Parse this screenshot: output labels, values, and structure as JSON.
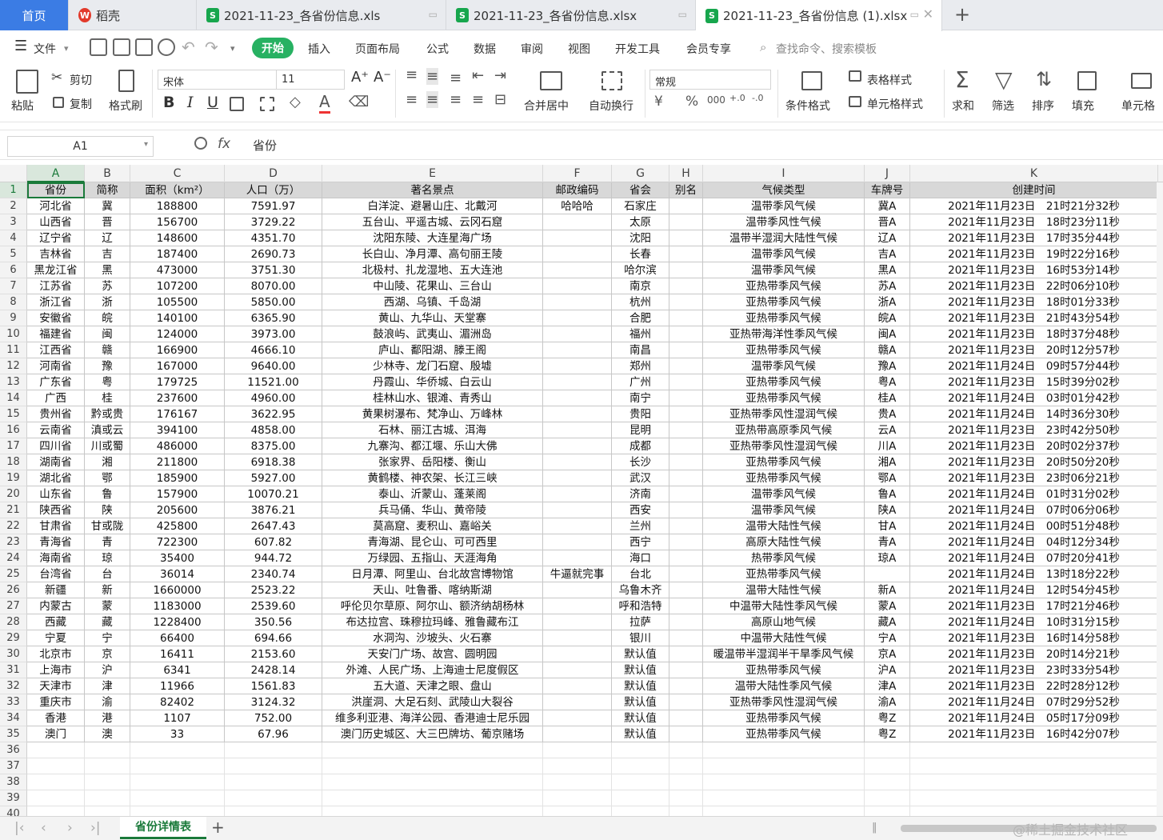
{
  "tabs": {
    "home": "首页",
    "daoke": "稻壳",
    "file1": "2021-11-23_各省份信息.xls",
    "file2": "2021-11-23_各省份信息.xlsx",
    "file3": "2021-11-23_各省份信息 (1).xlsx",
    "add": "+"
  },
  "menu": {
    "file": "文件",
    "items": [
      "开始",
      "插入",
      "页面布局",
      "公式",
      "数据",
      "审阅",
      "视图",
      "开发工具",
      "会员专享"
    ],
    "search": "查找命令、搜索模板"
  },
  "toolbar": {
    "paste": "粘贴",
    "cut": "剪切",
    "copy": "复制",
    "format_painter": "格式刷",
    "font": "宋体",
    "size": "11",
    "bold": "B",
    "italic": "I",
    "underline": "U",
    "merge": "合并居中",
    "wrap": "自动换行",
    "number_format": "常规",
    "cond_format": "条件格式",
    "table_style": "表格样式",
    "cell_style": "单元格样式",
    "sum": "求和",
    "filter": "筛选",
    "sort": "排序",
    "fill": "填充",
    "cell": "单元格"
  },
  "formula": {
    "namebox": "A1",
    "fx": "fx",
    "content": "省份"
  },
  "columns": [
    "A",
    "B",
    "C",
    "D",
    "E",
    "F",
    "G",
    "H",
    "I",
    "J",
    "K"
  ],
  "header_row": [
    "省份",
    "简称",
    "面积（km²）",
    "人口（万）",
    "著名景点",
    "邮政编码",
    "省会",
    "别名",
    "气候类型",
    "车牌号",
    "创建时间"
  ],
  "data_rows": [
    [
      "河北省",
      "冀",
      "188800",
      "7591.97",
      "白洋淀、避暑山庄、北戴河",
      "哈哈哈",
      "石家庄",
      "",
      "温带季风气候",
      "冀A",
      "2021年11月23日　21时21分32秒"
    ],
    [
      "山西省",
      "晋",
      "156700",
      "3729.22",
      "五台山、平遥古城、云冈石窟",
      "",
      "太原",
      "",
      "温带季风性气候",
      "晋A",
      "2021年11月23日　18时23分11秒"
    ],
    [
      "辽宁省",
      "辽",
      "148600",
      "4351.70",
      "沈阳东陵、大连星海广场",
      "",
      "沈阳",
      "",
      "温带半湿润大陆性气候",
      "辽A",
      "2021年11月23日　17时35分44秒"
    ],
    [
      "吉林省",
      "吉",
      "187400",
      "2690.73",
      "长白山、净月潭、高句丽王陵",
      "",
      "长春",
      "",
      "温带季风气候",
      "吉A",
      "2021年11月23日　19时22分16秒"
    ],
    [
      "黑龙江省",
      "黑",
      "473000",
      "3751.30",
      "北极村、扎龙湿地、五大连池",
      "",
      "哈尔滨",
      "",
      "温带季风气候",
      "黑A",
      "2021年11月23日　16时53分14秒"
    ],
    [
      "江苏省",
      "苏",
      "107200",
      "8070.00",
      "中山陵、花果山、三台山",
      "",
      "南京",
      "",
      "亚热带季风气候",
      "苏A",
      "2021年11月23日　22时06分10秒"
    ],
    [
      "浙江省",
      "浙",
      "105500",
      "5850.00",
      "西湖、乌镇、千岛湖",
      "",
      "杭州",
      "",
      "亚热带季风气候",
      "浙A",
      "2021年11月23日　18时01分33秒"
    ],
    [
      "安徽省",
      "皖",
      "140100",
      "6365.90",
      "黄山、九华山、天堂寨",
      "",
      "合肥",
      "",
      "亚热带季风气候",
      "皖A",
      "2021年11月23日　21时43分54秒"
    ],
    [
      "福建省",
      "闽",
      "124000",
      "3973.00",
      "鼓浪屿、武夷山、湄洲岛",
      "",
      "福州",
      "",
      "亚热带海洋性季风气候",
      "闽A",
      "2021年11月23日　18时37分48秒"
    ],
    [
      "江西省",
      "赣",
      "166900",
      "4666.10",
      "庐山、鄱阳湖、滕王阁",
      "",
      "南昌",
      "",
      "亚热带季风气候",
      "赣A",
      "2021年11月23日　20时12分57秒"
    ],
    [
      "河南省",
      "豫",
      "167000",
      "9640.00",
      "少林寺、龙门石窟、殷墟",
      "",
      "郑州",
      "",
      "温带季风气候",
      "豫A",
      "2021年11月24日　09时57分44秒"
    ],
    [
      "广东省",
      "粤",
      "179725",
      "11521.00",
      "丹霞山、华侨城、白云山",
      "",
      "广州",
      "",
      "亚热带季风气候",
      "粤A",
      "2021年11月23日　15时39分02秒"
    ],
    [
      "广西",
      "桂",
      "237600",
      "4960.00",
      "桂林山水、银滩、青秀山",
      "",
      "南宁",
      "",
      "亚热带季风气候",
      "桂A",
      "2021年11月24日　03时01分42秒"
    ],
    [
      "贵州省",
      "黔或贵",
      "176167",
      "3622.95",
      "黄果树瀑布、梵净山、万峰林",
      "",
      "贵阳",
      "",
      "亚热带季风性湿润气候",
      "贵A",
      "2021年11月24日　14时36分30秒"
    ],
    [
      "云南省",
      "滇或云",
      "394100",
      "4858.00",
      "石林、丽江古城、洱海",
      "",
      "昆明",
      "",
      "亚热带高原季风气候",
      "云A",
      "2021年11月23日　23时42分50秒"
    ],
    [
      "四川省",
      "川或蜀",
      "486000",
      "8375.00",
      "九寨沟、都江堰、乐山大佛",
      "",
      "成都",
      "",
      "亚热带季风性湿润气候",
      "川A",
      "2021年11月23日　20时02分37秒"
    ],
    [
      "湖南省",
      "湘",
      "211800",
      "6918.38",
      "张家界、岳阳楼、衡山",
      "",
      "长沙",
      "",
      "亚热带季风气候",
      "湘A",
      "2021年11月23日　20时50分20秒"
    ],
    [
      "湖北省",
      "鄂",
      "185900",
      "5927.00",
      "黄鹤楼、神农架、长江三峡",
      "",
      "武汉",
      "",
      "亚热带季风气候",
      "鄂A",
      "2021年11月23日　23时06分21秒"
    ],
    [
      "山东省",
      "鲁",
      "157900",
      "10070.21",
      "泰山、沂蒙山、蓬莱阁",
      "",
      "济南",
      "",
      "温带季风气候",
      "鲁A",
      "2021年11月24日　01时31分02秒"
    ],
    [
      "陕西省",
      "陕",
      "205600",
      "3876.21",
      "兵马俑、华山、黄帝陵",
      "",
      "西安",
      "",
      "温带季风气候",
      "陕A",
      "2021年11月24日　07时06分06秒"
    ],
    [
      "甘肃省",
      "甘或陇",
      "425800",
      "2647.43",
      "莫高窟、麦积山、嘉峪关",
      "",
      "兰州",
      "",
      "温带大陆性气候",
      "甘A",
      "2021年11月24日　00时51分48秒"
    ],
    [
      "青海省",
      "青",
      "722300",
      "607.82",
      "青海湖、昆仑山、可可西里",
      "",
      "西宁",
      "",
      "高原大陆性气候",
      "青A",
      "2021年11月24日　04时12分34秒"
    ],
    [
      "海南省",
      "琼",
      "35400",
      "944.72",
      "万绿园、五指山、天涯海角",
      "",
      "海口",
      "",
      "热带季风气候",
      "琼A",
      "2021年11月24日　07时20分41秒"
    ],
    [
      "台湾省",
      "台",
      "36014",
      "2340.74",
      "日月潭、阿里山、台北故宫博物馆",
      "牛逼就完事",
      "台北",
      "",
      "亚热带季风气候",
      "",
      "2021年11月24日　13时18分22秒"
    ],
    [
      "新疆",
      "新",
      "1660000",
      "2523.22",
      "天山、吐鲁番、喀纳斯湖",
      "",
      "乌鲁木齐",
      "",
      "温带大陆性气候",
      "新A",
      "2021年11月24日　12时54分45秒"
    ],
    [
      "内蒙古",
      "蒙",
      "1183000",
      "2539.60",
      "呼伦贝尔草原、阿尔山、额济纳胡杨林",
      "",
      "呼和浩特",
      "",
      "中温带大陆性季风气候",
      "蒙A",
      "2021年11月23日　17时21分46秒"
    ],
    [
      "西藏",
      "藏",
      "1228400",
      "350.56",
      "布达拉宫、珠穆拉玛峰、雅鲁藏布江",
      "",
      "拉萨",
      "",
      "高原山地气候",
      "藏A",
      "2021年11月24日　10时31分15秒"
    ],
    [
      "宁夏",
      "宁",
      "66400",
      "694.66",
      "水洞沟、沙坡头、火石寨",
      "",
      "银川",
      "",
      "中温带大陆性气候",
      "宁A",
      "2021年11月23日　16时14分58秒"
    ],
    [
      "北京市",
      "京",
      "16411",
      "2153.60",
      "天安门广场、故宫、圆明园",
      "",
      "默认值",
      "",
      "暖温带半湿润半干旱季风气候",
      "京A",
      "2021年11月23日　20时14分21秒"
    ],
    [
      "上海市",
      "沪",
      "6341",
      "2428.14",
      "外滩、人民广场、上海迪士尼度假区",
      "",
      "默认值",
      "",
      "亚热带季风气候",
      "沪A",
      "2021年11月23日　23时33分54秒"
    ],
    [
      "天津市",
      "津",
      "11966",
      "1561.83",
      "五大道、天津之眼、盘山",
      "",
      "默认值",
      "",
      "温带大陆性季风气候",
      "津A",
      "2021年11月23日　22时28分12秒"
    ],
    [
      "重庆市",
      "渝",
      "82402",
      "3124.32",
      "洪崖洞、大足石刻、武陵山大裂谷",
      "",
      "默认值",
      "",
      "亚热带季风性湿润气候",
      "渝A",
      "2021年11月24日　07时29分52秒"
    ],
    [
      "香港",
      "港",
      "1107",
      "752.00",
      "维多利亚港、海洋公园、香港迪士尼乐园",
      "",
      "默认值",
      "",
      "亚热带季风气候",
      "粤Z",
      "2021年11月24日　05时17分09秒"
    ],
    [
      "澳门",
      "澳",
      "33",
      "67.96",
      "澳门历史城区、大三巴牌坊、葡京赌场",
      "",
      "默认值",
      "",
      "亚热带季风气候",
      "粤Z",
      "2021年11月23日　16时42分07秒"
    ]
  ],
  "empty_rows": [
    "36",
    "37",
    "38",
    "39",
    "40"
  ],
  "sheet": {
    "name": "省份详情表",
    "add": "+"
  },
  "watermark": "@稀土掘金技术社区",
  "colors": {
    "accent": "#27b162",
    "selection": "#1a7a3a",
    "home_tab": "#3b7ce4"
  }
}
